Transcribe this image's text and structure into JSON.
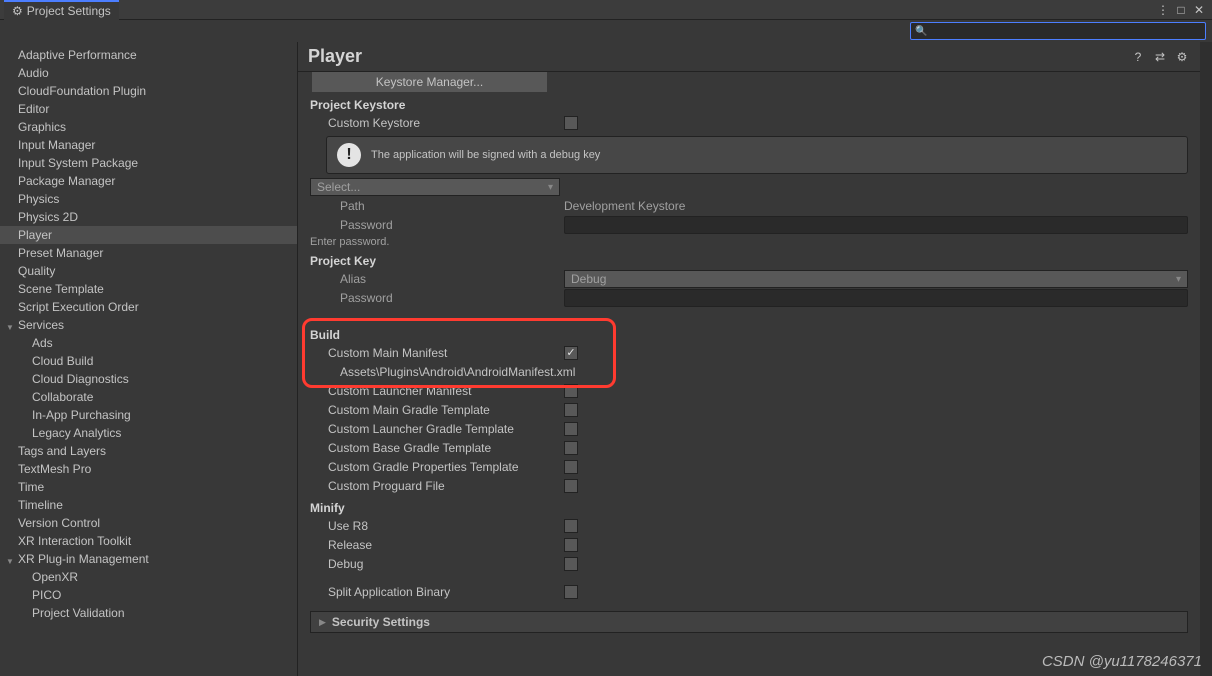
{
  "window": {
    "title": "Project Settings"
  },
  "header": {
    "title": "Player"
  },
  "search": {
    "placeholder": ""
  },
  "sidebar": {
    "items": [
      {
        "label": "Adaptive Performance"
      },
      {
        "label": "Audio"
      },
      {
        "label": "CloudFoundation Plugin"
      },
      {
        "label": "Editor"
      },
      {
        "label": "Graphics"
      },
      {
        "label": "Input Manager"
      },
      {
        "label": "Input System Package"
      },
      {
        "label": "Package Manager"
      },
      {
        "label": "Physics"
      },
      {
        "label": "Physics 2D"
      },
      {
        "label": "Player",
        "selected": true
      },
      {
        "label": "Preset Manager"
      },
      {
        "label": "Quality"
      },
      {
        "label": "Scene Template"
      },
      {
        "label": "Script Execution Order"
      },
      {
        "label": "Services",
        "expand": true,
        "children": [
          {
            "label": "Ads"
          },
          {
            "label": "Cloud Build"
          },
          {
            "label": "Cloud Diagnostics"
          },
          {
            "label": "Collaborate"
          },
          {
            "label": "In-App Purchasing"
          },
          {
            "label": "Legacy Analytics"
          }
        ]
      },
      {
        "label": "Tags and Layers"
      },
      {
        "label": "TextMesh Pro"
      },
      {
        "label": "Time"
      },
      {
        "label": "Timeline"
      },
      {
        "label": "Version Control"
      },
      {
        "label": "XR Interaction Toolkit"
      },
      {
        "label": "XR Plug-in Management",
        "expand": true,
        "children": [
          {
            "label": "OpenXR"
          },
          {
            "label": "PICO"
          },
          {
            "label": "Project Validation"
          }
        ]
      }
    ]
  },
  "keystore": {
    "manager_btn": "Keystore Manager...",
    "section": "Project Keystore",
    "custom_label": "Custom Keystore",
    "info": "The application will be signed with a debug key",
    "select_dd": "Select...",
    "path_label": "Path",
    "path_value": "Development Keystore",
    "password_label": "Password",
    "hint": "Enter password."
  },
  "projectkey": {
    "section": "Project Key",
    "alias_label": "Alias",
    "alias_value": "Debug",
    "password_label": "Password"
  },
  "build": {
    "section": "Build",
    "custom_manifest": "Custom Main Manifest",
    "manifest_path": "Assets\\Plugins\\Android\\AndroidManifest.xml",
    "items": [
      "Custom Launcher Manifest",
      "Custom Main Gradle Template",
      "Custom Launcher Gradle Template",
      "Custom Base Gradle Template",
      "Custom Gradle Properties Template",
      "Custom Proguard File"
    ]
  },
  "minify": {
    "section": "Minify",
    "items": [
      "Use R8",
      "Release",
      "Debug"
    ]
  },
  "split": {
    "label": "Split Application Binary"
  },
  "security": {
    "label": "Security Settings"
  },
  "watermark": "CSDN @yu1178246371"
}
